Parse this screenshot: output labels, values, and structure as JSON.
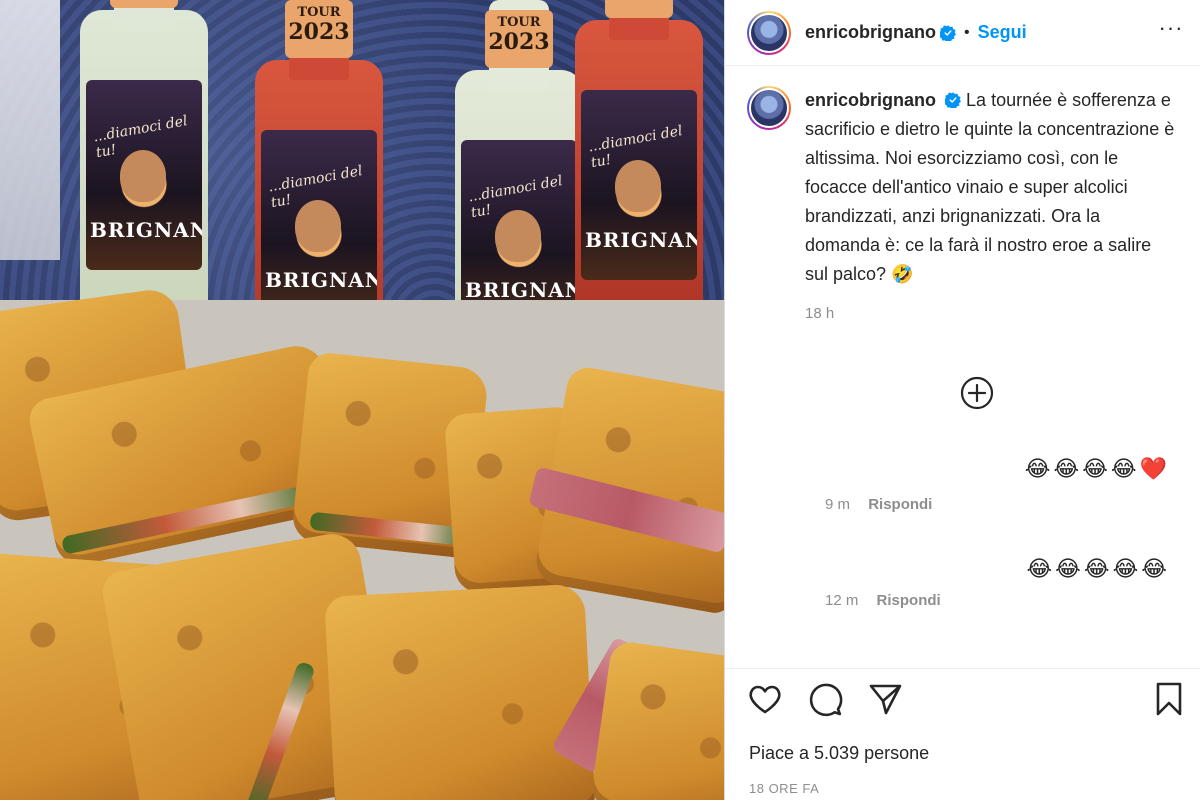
{
  "colors": {
    "link": "#0095f6",
    "text": "#262626",
    "muted": "#8e8e8e",
    "verified": "#0095f6",
    "heart": "#ed4956"
  },
  "header": {
    "username": "enricobrignano",
    "separator": "•",
    "follow_label": "Segui",
    "more_label": "···"
  },
  "photo": {
    "bottle_cap_line1": "TOUR",
    "bottle_cap_line2": "2023",
    "bottle_script": "...diamoci del tu!",
    "bottle_brand": "BRIGNANO"
  },
  "caption": {
    "username": "enricobrignano",
    "text": "La tournée è sofferenza e sacrificio e dietro le quinte la concentrazione è altissima. Noi esorcizziamo così, con le focacce dell'antico vinaio e super alcolici brandizzati, anzi brignanizzati. Ora la domanda è: ce la farà il nostro eroe a salire sul palco? 🤣",
    "time": "18 h"
  },
  "comments": [
    {
      "emojis": "😂😂😂😂❤️",
      "time": "9 m",
      "reply_label": "Rispondi"
    },
    {
      "emojis": "😂😂😂😂😂",
      "time": "12 m",
      "reply_label": "Rispondi"
    }
  ],
  "actions": {
    "icons": [
      "heart-icon",
      "comment-icon",
      "share-icon",
      "bookmark-icon"
    ],
    "likes_text": "Piace a 5.039 persone",
    "posted_text": "18 ORE FA"
  }
}
